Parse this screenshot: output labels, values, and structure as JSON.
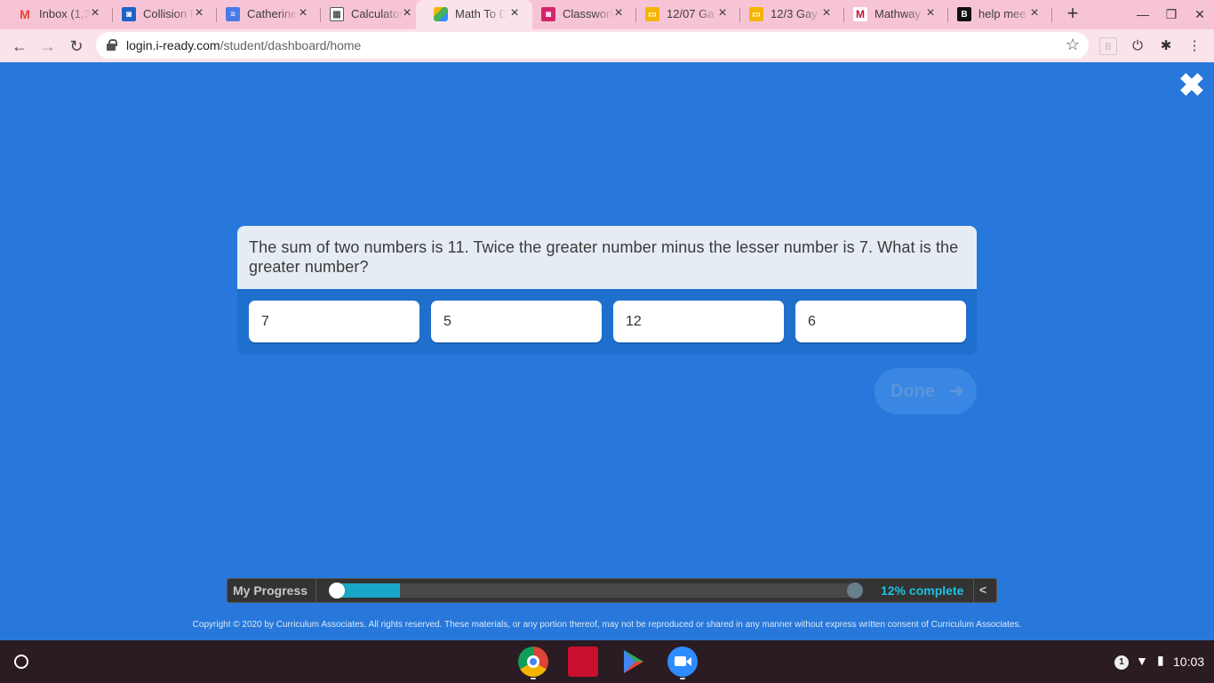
{
  "browser": {
    "tabs": [
      {
        "title": "Inbox (1,3",
        "icon": "gmail-icon",
        "color": "#ea4335",
        "active": false
      },
      {
        "title": "Collision F",
        "icon": "classroom-icon",
        "color": "#1e63c8",
        "active": false
      },
      {
        "title": "Catherine",
        "icon": "docs-icon",
        "color": "#4a7ae8",
        "active": false
      },
      {
        "title": "Calculator",
        "icon": "calculator-icon",
        "color": "#555555",
        "active": false
      },
      {
        "title": "Math To D",
        "icon": "iready-icon",
        "color": "#46b05a",
        "active": true
      },
      {
        "title": "Classwork",
        "icon": "classroom-icon",
        "color": "#d6246c",
        "active": false
      },
      {
        "title": "12/07 Ga",
        "icon": "slides-icon",
        "color": "#f5b400",
        "active": false
      },
      {
        "title": "12/3 Gay",
        "icon": "slides-icon",
        "color": "#f5b400",
        "active": false
      },
      {
        "title": "Mathway",
        "icon": "mathway-icon",
        "color": "#c8102e",
        "active": false
      },
      {
        "title": "help mee",
        "icon": "brainly-icon",
        "color": "#111111",
        "active": false
      }
    ],
    "url_host": "login.i-ready.com",
    "url_path": "/student/dashboard/home"
  },
  "question": {
    "text": "The sum of two numbers is 11. Twice the greater number minus the lesser number is 7. What is the greater number?",
    "answers": [
      "7",
      "5",
      "12",
      "6"
    ]
  },
  "done_label": "Done",
  "progress": {
    "label": "My Progress",
    "percent_text": "12% complete",
    "fraction": 0.12,
    "collapse": "<"
  },
  "copyright": "Copyright © 2020 by Curriculum Associates. All rights reserved. These materials, or any portion thereof, may not be reproduced or shared in any manner without express written consent of Curriculum Associates.",
  "taskbar": {
    "apps": [
      {
        "name": "chrome-icon",
        "color": "#db4437"
      },
      {
        "name": "sketchup-icon",
        "color": "#c8102e"
      },
      {
        "name": "play-store-icon",
        "color": "#01875f"
      },
      {
        "name": "zoom-icon",
        "color": "#2d8cff"
      }
    ],
    "notification_count": "1",
    "clock": "10:03"
  },
  "colors": {
    "page_background": "#2778da",
    "progress_fill": "#1aa7c7"
  }
}
